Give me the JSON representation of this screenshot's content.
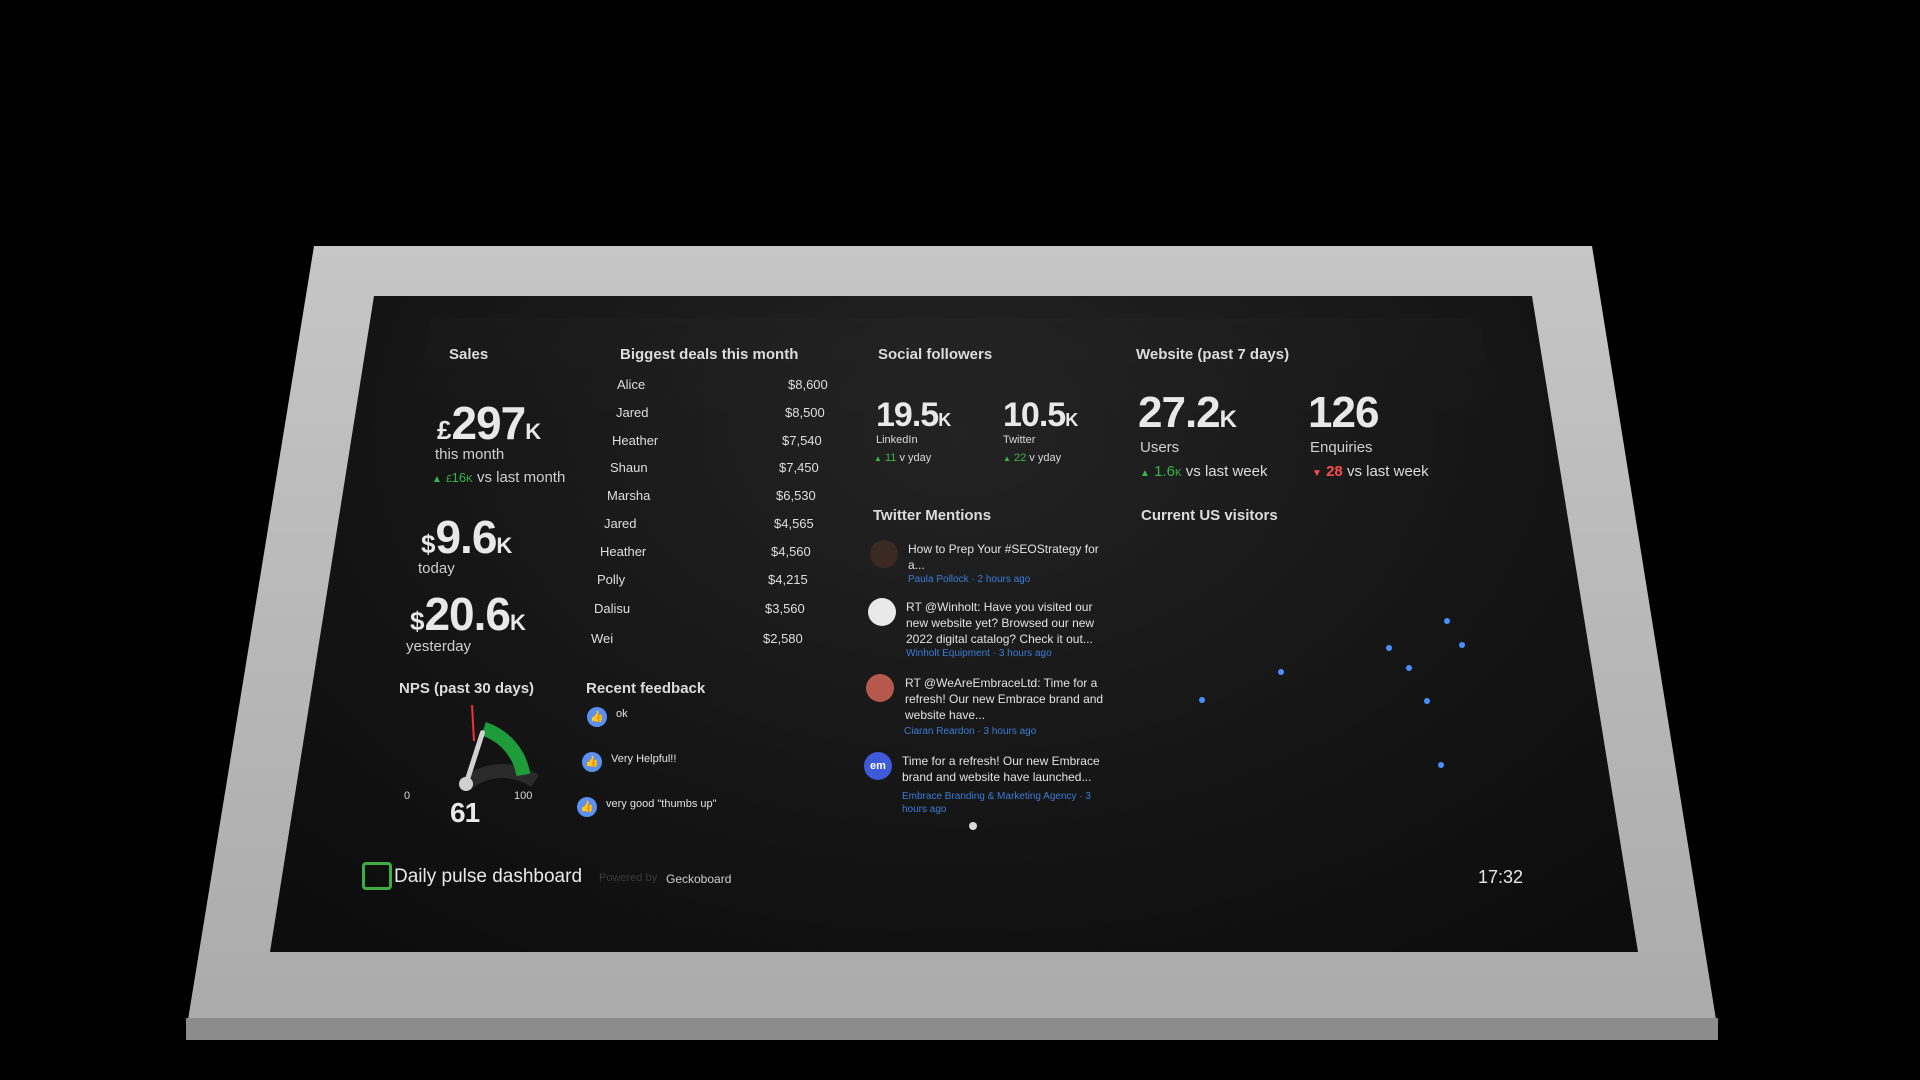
{
  "sales": {
    "title": "Sales",
    "month_prefix": "£",
    "month_value": "297",
    "month_suffix": "K",
    "month_label": "this month",
    "month_delta_prefix": "£",
    "month_delta_value": "16",
    "month_delta_suffix": "K",
    "month_delta_label": "vs last month",
    "today_prefix": "$",
    "today_value": "9.6",
    "today_suffix": "K",
    "today_label": "today",
    "yesterday_prefix": "$",
    "yesterday_value": "20.6",
    "yesterday_suffix": "K",
    "yesterday_label": "yesterday"
  },
  "deals": {
    "title": "Biggest deals this month",
    "rows": [
      {
        "name": "Alice",
        "value": "$8,600"
      },
      {
        "name": "Jared",
        "value": "$8,500"
      },
      {
        "name": "Heather",
        "value": "$7,540"
      },
      {
        "name": "Shaun",
        "value": "$7,450"
      },
      {
        "name": "Marsha",
        "value": "$6,530"
      },
      {
        "name": "Jared",
        "value": "$4,565"
      },
      {
        "name": "Heather",
        "value": "$4,560"
      },
      {
        "name": "Polly",
        "value": "$4,215"
      },
      {
        "name": "Dalisu",
        "value": "$3,560"
      },
      {
        "name": "Wei",
        "value": "$2,580"
      }
    ]
  },
  "social": {
    "title": "Social followers",
    "linkedin_value": "19.5",
    "linkedin_suffix": "K",
    "linkedin_label": "LinkedIn",
    "linkedin_delta": "11",
    "linkedin_delta_label": "v yday",
    "twitter_value": "10.5",
    "twitter_suffix": "K",
    "twitter_label": "Twitter",
    "twitter_delta": "22",
    "twitter_delta_label": "v yday"
  },
  "website": {
    "title": "Website (past 7 days)",
    "users_value": "27.2",
    "users_suffix": "K",
    "users_label": "Users",
    "users_delta_prefix": "1.6",
    "users_delta_suffix": "K",
    "users_delta_label": "vs last week",
    "enquiries_value": "126",
    "enquiries_label": "Enquiries",
    "enquiries_delta": "28",
    "enquiries_delta_label": "vs last week",
    "visitors_title": "Current US visitors"
  },
  "twitter": {
    "title": "Twitter Mentions",
    "tweets": [
      {
        "text": "How to Prep Your #SEOStrategy for a...",
        "meta": "Paula Pollock · 2 hours ago"
      },
      {
        "text": "RT @Winholt: Have you visited our new website yet? Browsed our new 2022 digital catalog? Check it out...",
        "meta": "Winholt Equipment · 3 hours ago"
      },
      {
        "text": "RT @WeAreEmbraceLtd: Time for a refresh! Our new Embrace brand and website have...",
        "meta": "Ciaran Reardon · 3 hours ago"
      },
      {
        "text": "Time for a refresh! Our new Embrace brand and website have launched...",
        "meta": "Embrace Branding & Marketing Agency · 3 hours ago"
      }
    ],
    "avatar_em": "em"
  },
  "nps": {
    "title": "NPS (past 30 days)",
    "value": "61",
    "min": "0",
    "max": "100",
    "score": 61
  },
  "feedback": {
    "title": "Recent feedback",
    "items": [
      {
        "text": "ok"
      },
      {
        "text": "Very Helpful!!"
      },
      {
        "text": "very good \"thumbs up\""
      }
    ]
  },
  "footer": {
    "dashboard_name": "Daily pulse dashboard",
    "powered_by": "Powered by",
    "brand": "Geckoboard",
    "clock": "17:32"
  },
  "colors": {
    "positive": "#39b54a",
    "negative": "#ff4b4b",
    "link": "#3a7bd5",
    "map_dot": "#4a8fff"
  }
}
